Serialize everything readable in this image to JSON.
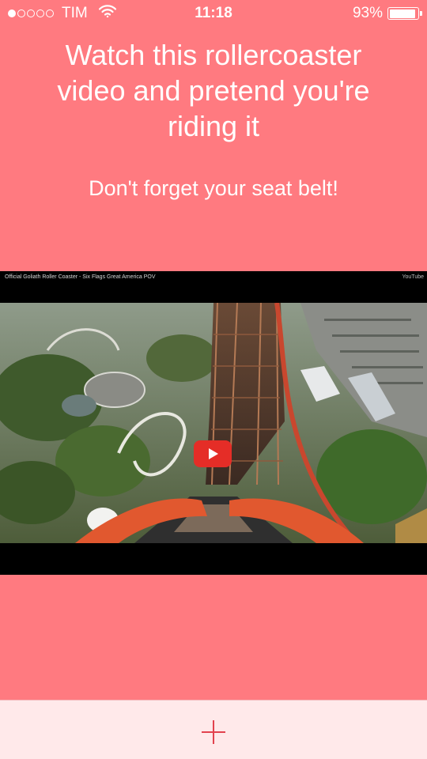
{
  "status_bar": {
    "carrier": "TIM",
    "time": "11:18",
    "battery_text": "93%",
    "battery_level": 0.93,
    "signal_dots_filled": 1,
    "signal_dots_total": 5
  },
  "content": {
    "headline": "Watch this rollercoaster video and pretend you're riding it",
    "subline": "Don't forget your seat belt!"
  },
  "video": {
    "title": "Official Goliath Roller Coaster - Six Flags Great America POV",
    "brand": "YouTube",
    "play_icon": "youtube-play-icon"
  },
  "bottom_bar": {
    "add_icon": "plus-icon"
  },
  "colors": {
    "background": "#ff7a80",
    "bottom_bar": "#ffe9ea",
    "accent": "#e2424e",
    "youtube_red": "#e52d27"
  }
}
